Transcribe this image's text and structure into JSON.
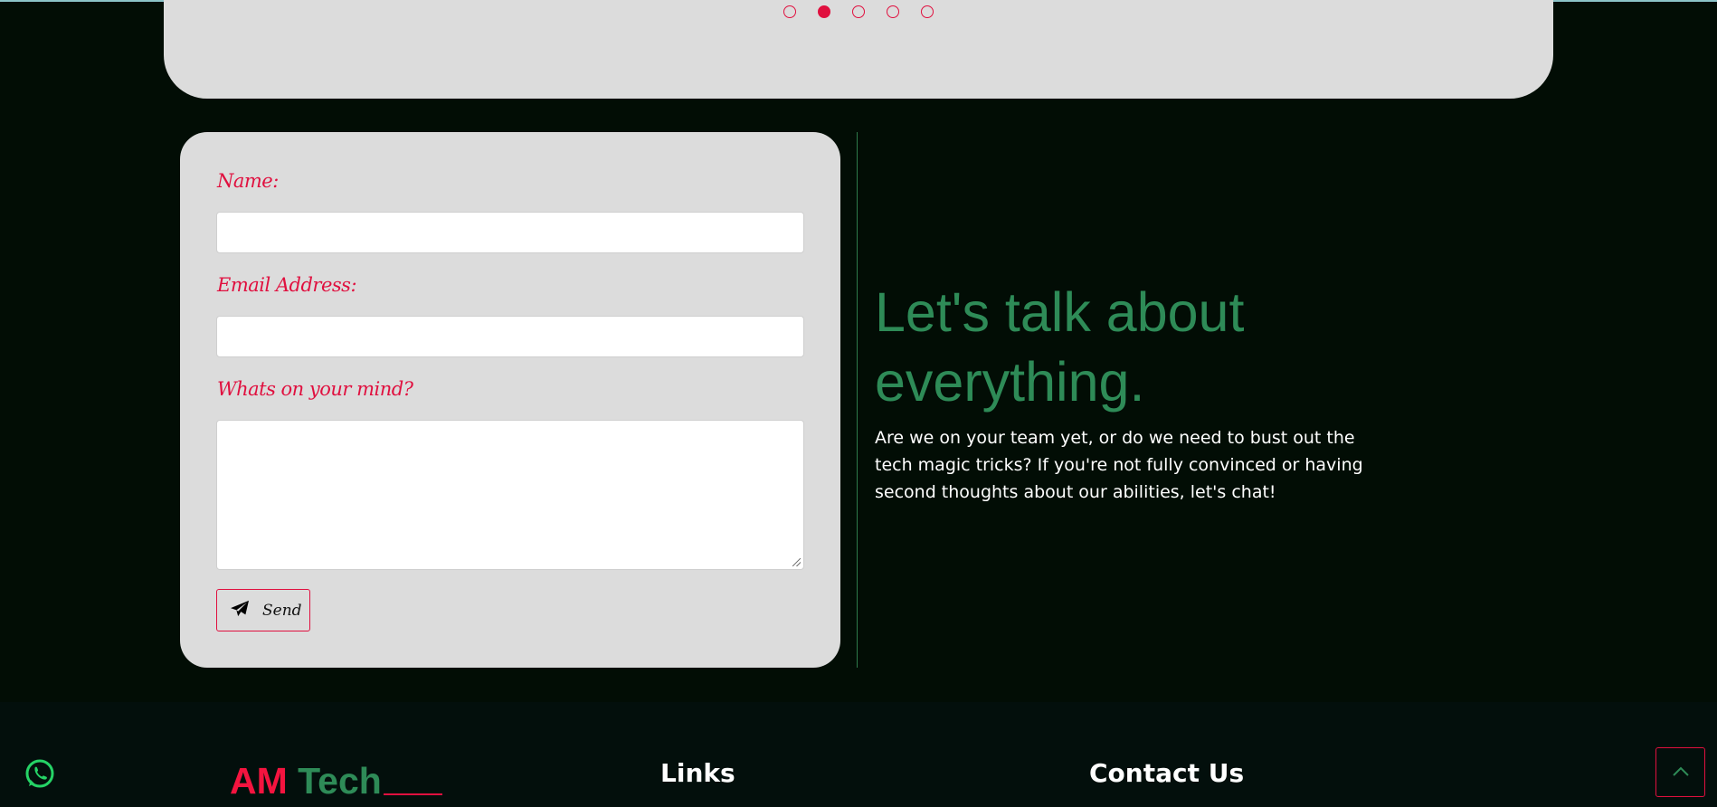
{
  "carousel": {
    "dots": [
      {
        "active": false
      },
      {
        "active": true
      },
      {
        "active": false
      },
      {
        "active": false
      },
      {
        "active": false
      }
    ]
  },
  "contact_form": {
    "name_label": "Name:",
    "name_value": "",
    "email_label": "Email Address:",
    "email_value": "",
    "message_label": "Whats on your mind?",
    "message_value": "",
    "send_label": "Send"
  },
  "intro": {
    "headline": "Let's talk about everything.",
    "body": "Are we on your team yet, or do we need to bust out the tech magic tricks? If you're not fully convinced or having second thoughts about our abilities, let's chat!"
  },
  "footer": {
    "brand_part1": "AM",
    "brand_part2": "Tech",
    "links_heading": "Links",
    "contact_heading": "Contact Us"
  },
  "colors": {
    "accent": "#e0103f",
    "brand_green": "#2e8b57",
    "background": "#020d05",
    "card": "#dcdcdc"
  },
  "icons": {
    "send": "paper-plane-icon",
    "whatsapp": "whatsapp-icon",
    "scroll_top": "chevron-up-icon"
  }
}
